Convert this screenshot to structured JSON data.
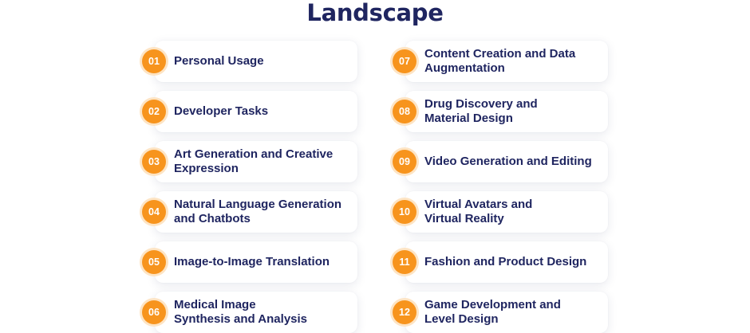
{
  "title": "Landscape",
  "items": [
    {
      "num": "01",
      "label": "Personal Usage"
    },
    {
      "num": "02",
      "label": "Developer Tasks"
    },
    {
      "num": "03",
      "label": "Art Generation and Creative\nExpression"
    },
    {
      "num": "04",
      "label": "Natural Language Generation\nand Chatbots"
    },
    {
      "num": "05",
      "label": "Image-to-Image Translation"
    },
    {
      "num": "06",
      "label": "Medical Image\nSynthesis and Analysis"
    },
    {
      "num": "07",
      "label": "Content Creation and Data\nAugmentation"
    },
    {
      "num": "08",
      "label": "Drug Discovery and\nMaterial Design"
    },
    {
      "num": "09",
      "label": "Video Generation and Editing"
    },
    {
      "num": "10",
      "label": "Virtual Avatars and\nVirtual Reality"
    },
    {
      "num": "11",
      "label": "Fashion and Product Design"
    },
    {
      "num": "12",
      "label": "Game Development and\nLevel Design"
    }
  ],
  "colors": {
    "accent": "#f7941d",
    "text": "#1f2560"
  }
}
